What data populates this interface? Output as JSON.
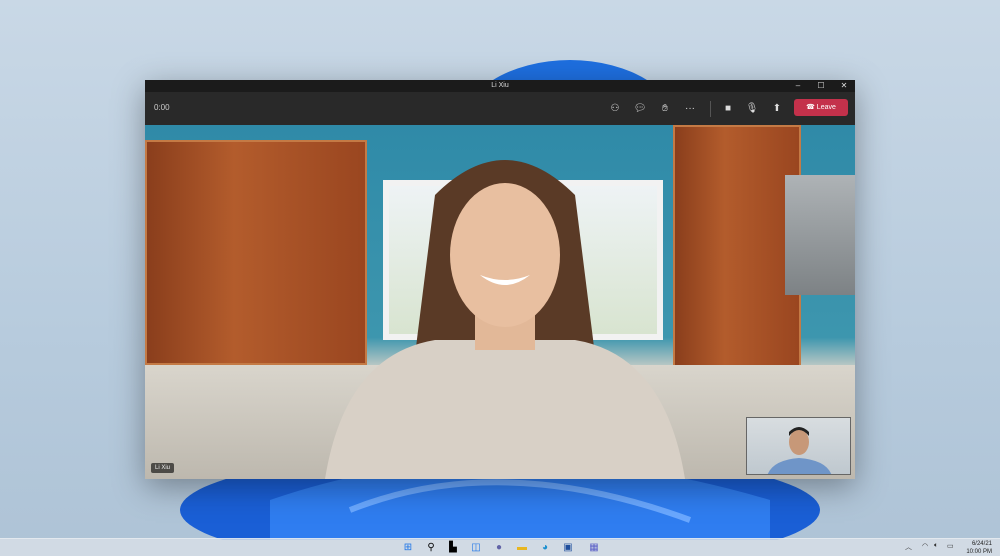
{
  "window": {
    "title": "Li Xiu",
    "minimize": "–",
    "maximize": "☐",
    "close": "✕"
  },
  "call": {
    "timer": "0:00",
    "leave_label": "Leave",
    "participant_name": "Li Xiu"
  },
  "toolbar": {
    "icons": [
      "people-icon",
      "chat-icon",
      "raise-hand-icon",
      "more-icon",
      "camera-icon",
      "mic-icon",
      "share-icon"
    ]
  },
  "taskbar": {
    "date": "6/24/21",
    "time": "10:00 PM"
  },
  "colors": {
    "leave": "#c4314b",
    "toolbar": "#292929",
    "accent": "#0f6cbd"
  }
}
